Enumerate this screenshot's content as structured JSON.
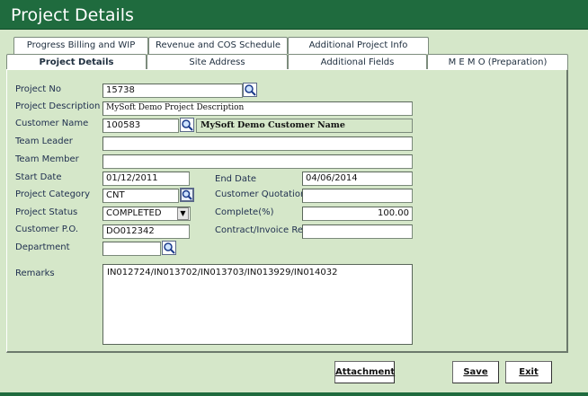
{
  "window": {
    "title": "Project Details"
  },
  "tabs_row1": [
    {
      "label": "Progress Billing and WIP"
    },
    {
      "label": "Revenue and COS Schedule"
    },
    {
      "label": "Additional Project Info"
    }
  ],
  "tabs_row2": [
    {
      "label": "Project  Details",
      "active": true
    },
    {
      "label": "Site Address"
    },
    {
      "label": "Additional Fields"
    },
    {
      "label": "M E M O  (Preparation)"
    }
  ],
  "form": {
    "project_no": {
      "label": "Project No",
      "value": "15738"
    },
    "project_description": {
      "label": "Project Description",
      "value": "MySoft Demo Project Description"
    },
    "customer_name": {
      "label": "Customer Name",
      "code": "100583",
      "name": "MySoft Demo Customer Name"
    },
    "team_leader": {
      "label": "Team Leader",
      "value": ""
    },
    "team_member": {
      "label": "Team Member",
      "value": ""
    },
    "start_date": {
      "label": "Start Date",
      "value": "01/12/2011"
    },
    "end_date": {
      "label": "End Date",
      "value": "04/06/2014"
    },
    "project_category": {
      "label": "Project Category",
      "value": "CNT"
    },
    "customer_quotation": {
      "label": "Customer Quotation",
      "value": ""
    },
    "project_status": {
      "label": "Project Status",
      "value": "COMPLETED"
    },
    "complete_pct": {
      "label": "Complete(%)",
      "value": "100.00"
    },
    "customer_po": {
      "label": "Customer P.O.",
      "value": "DO012342"
    },
    "contract_invoice_ref": {
      "label": "Contract/Invoice Ref",
      "value": ""
    },
    "department": {
      "label": "Department",
      "value": ""
    },
    "remarks": {
      "label": "Remarks",
      "value": "IN012724/IN013702/IN013703/IN013929/IN014032"
    }
  },
  "buttons": {
    "attachment": "Attachment",
    "save": "Save",
    "exit": "Exit"
  },
  "colors": {
    "titlebar": "#1f6b3e",
    "background": "#d5e7c9"
  }
}
